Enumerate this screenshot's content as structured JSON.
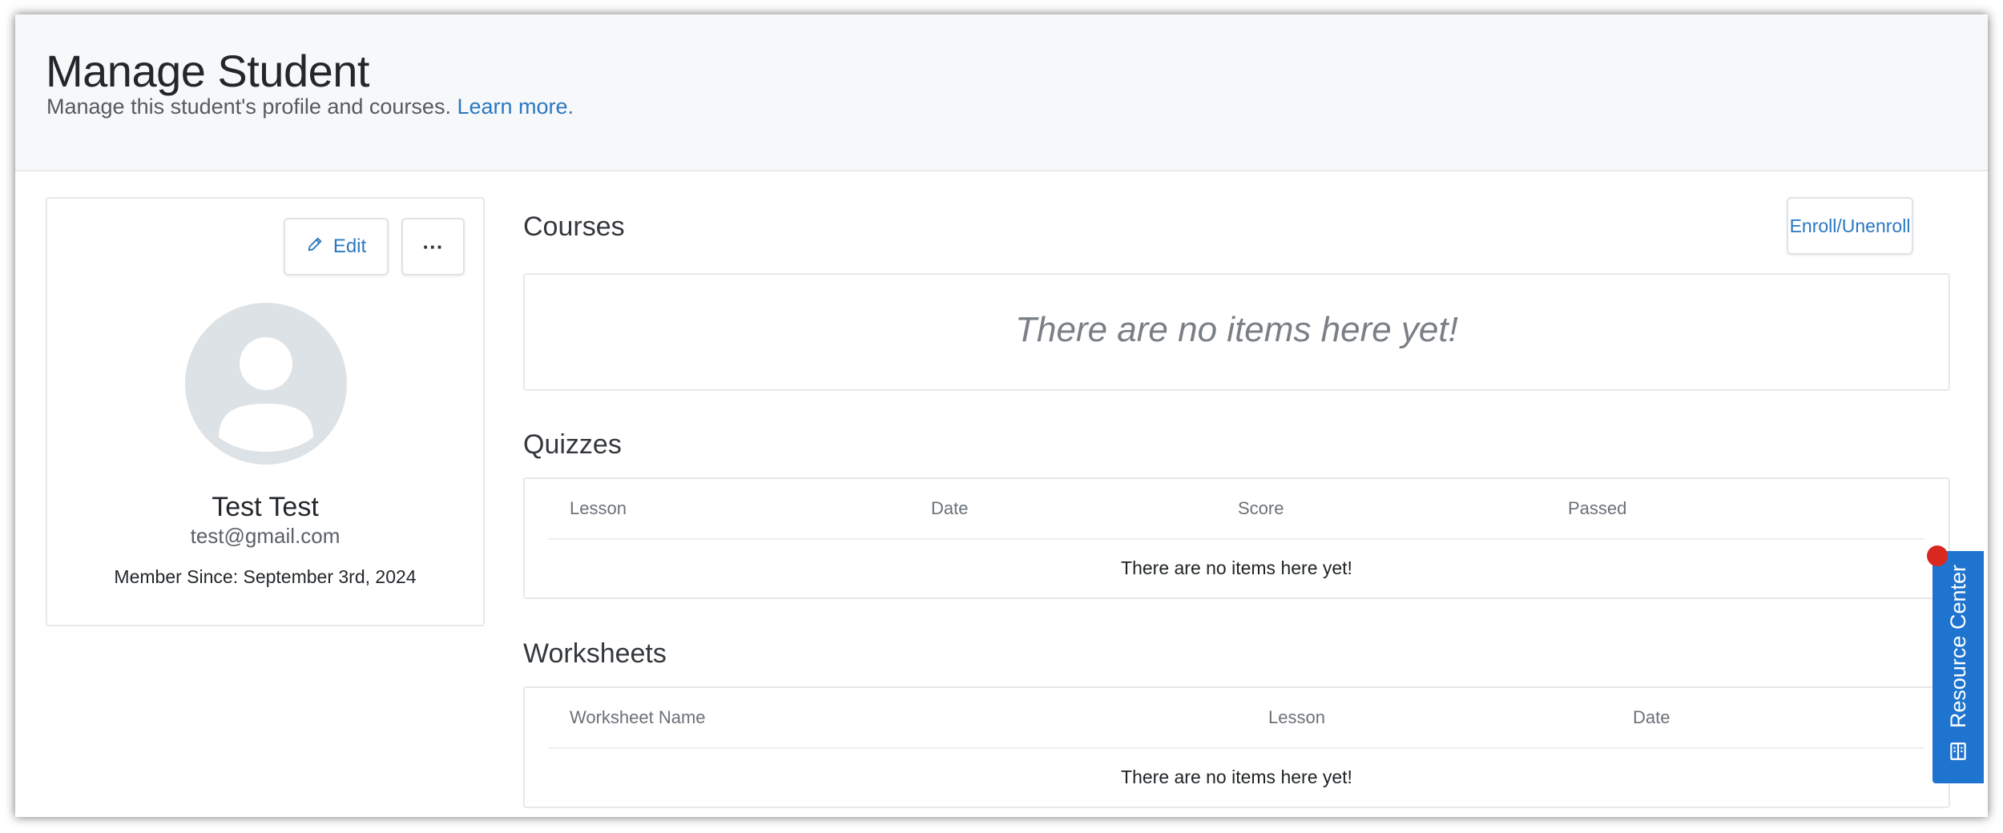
{
  "header": {
    "title": "Manage Student",
    "subtitle": "Manage this student's profile and courses.",
    "learn_more": "Learn more."
  },
  "profile": {
    "edit_label": "Edit",
    "more_label": "···",
    "name": "Test Test",
    "email": "test@gmail.com",
    "member_since": "Member Since: September 3rd, 2024"
  },
  "courses": {
    "title": "Courses",
    "enroll_label": "Enroll/Unenroll",
    "empty": "There are no items here yet!"
  },
  "quizzes": {
    "title": "Quizzes",
    "columns": [
      "Lesson",
      "Date",
      "Score",
      "Passed"
    ],
    "empty": "There are no items here yet!"
  },
  "worksheets": {
    "title": "Worksheets",
    "columns": [
      "Worksheet Name",
      "Lesson",
      "Date"
    ],
    "empty": "There are no items here yet!"
  },
  "resource_center": {
    "label": "Resource Center"
  },
  "colors": {
    "accent": "#2a78c2",
    "resource_tab": "#1f74cf",
    "notification_dot": "#d8281f",
    "avatar_bg": "#dde2e6"
  }
}
